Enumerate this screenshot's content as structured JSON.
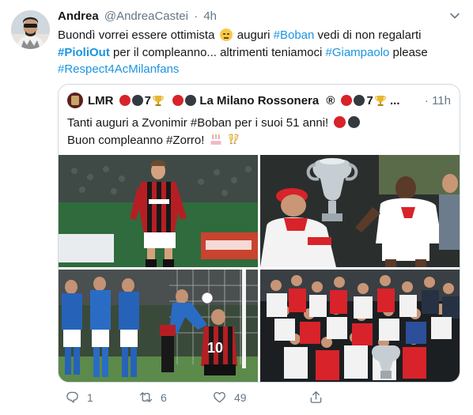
{
  "tweet": {
    "author_name": "Andrea",
    "handle": "@AndreaCastei",
    "separator": "·",
    "time": "4h",
    "text": {
      "l1a": "Buondì vorrei essere ottimista",
      "l1b": "auguri",
      "l1tag": "#Boban",
      "l1c": "vedi di non regalarti",
      "l2tag": "#PioliOut",
      "l2a": "per il compleanno... altrimenti teniamoci",
      "l2tag2": "#Giampaolo",
      "l2b": "please",
      "l3tag": "#Respect4AcMilanfans"
    }
  },
  "quote": {
    "name": "LMR",
    "seven1": "7",
    "name2": "La Milano Rossonera",
    "reg": "®",
    "seven2": "7",
    "ellipsis": "...",
    "separator": "·",
    "time": "11h",
    "line1": "Tanti auguri a Zvonimir #Boban per i suoi 51 anni!",
    "line2": "Buon compleanno #Zorro!"
  },
  "actions": {
    "replies": "1",
    "retweets": "6",
    "likes": "49"
  },
  "icons": {
    "caret": "chevron-down-icon",
    "reply": "reply-icon",
    "retweet": "retweet-icon",
    "like": "heart-icon",
    "share": "share-icon"
  },
  "colors": {
    "link": "#1b95e0",
    "muted": "#657786",
    "milan_red": "#d8232a"
  }
}
